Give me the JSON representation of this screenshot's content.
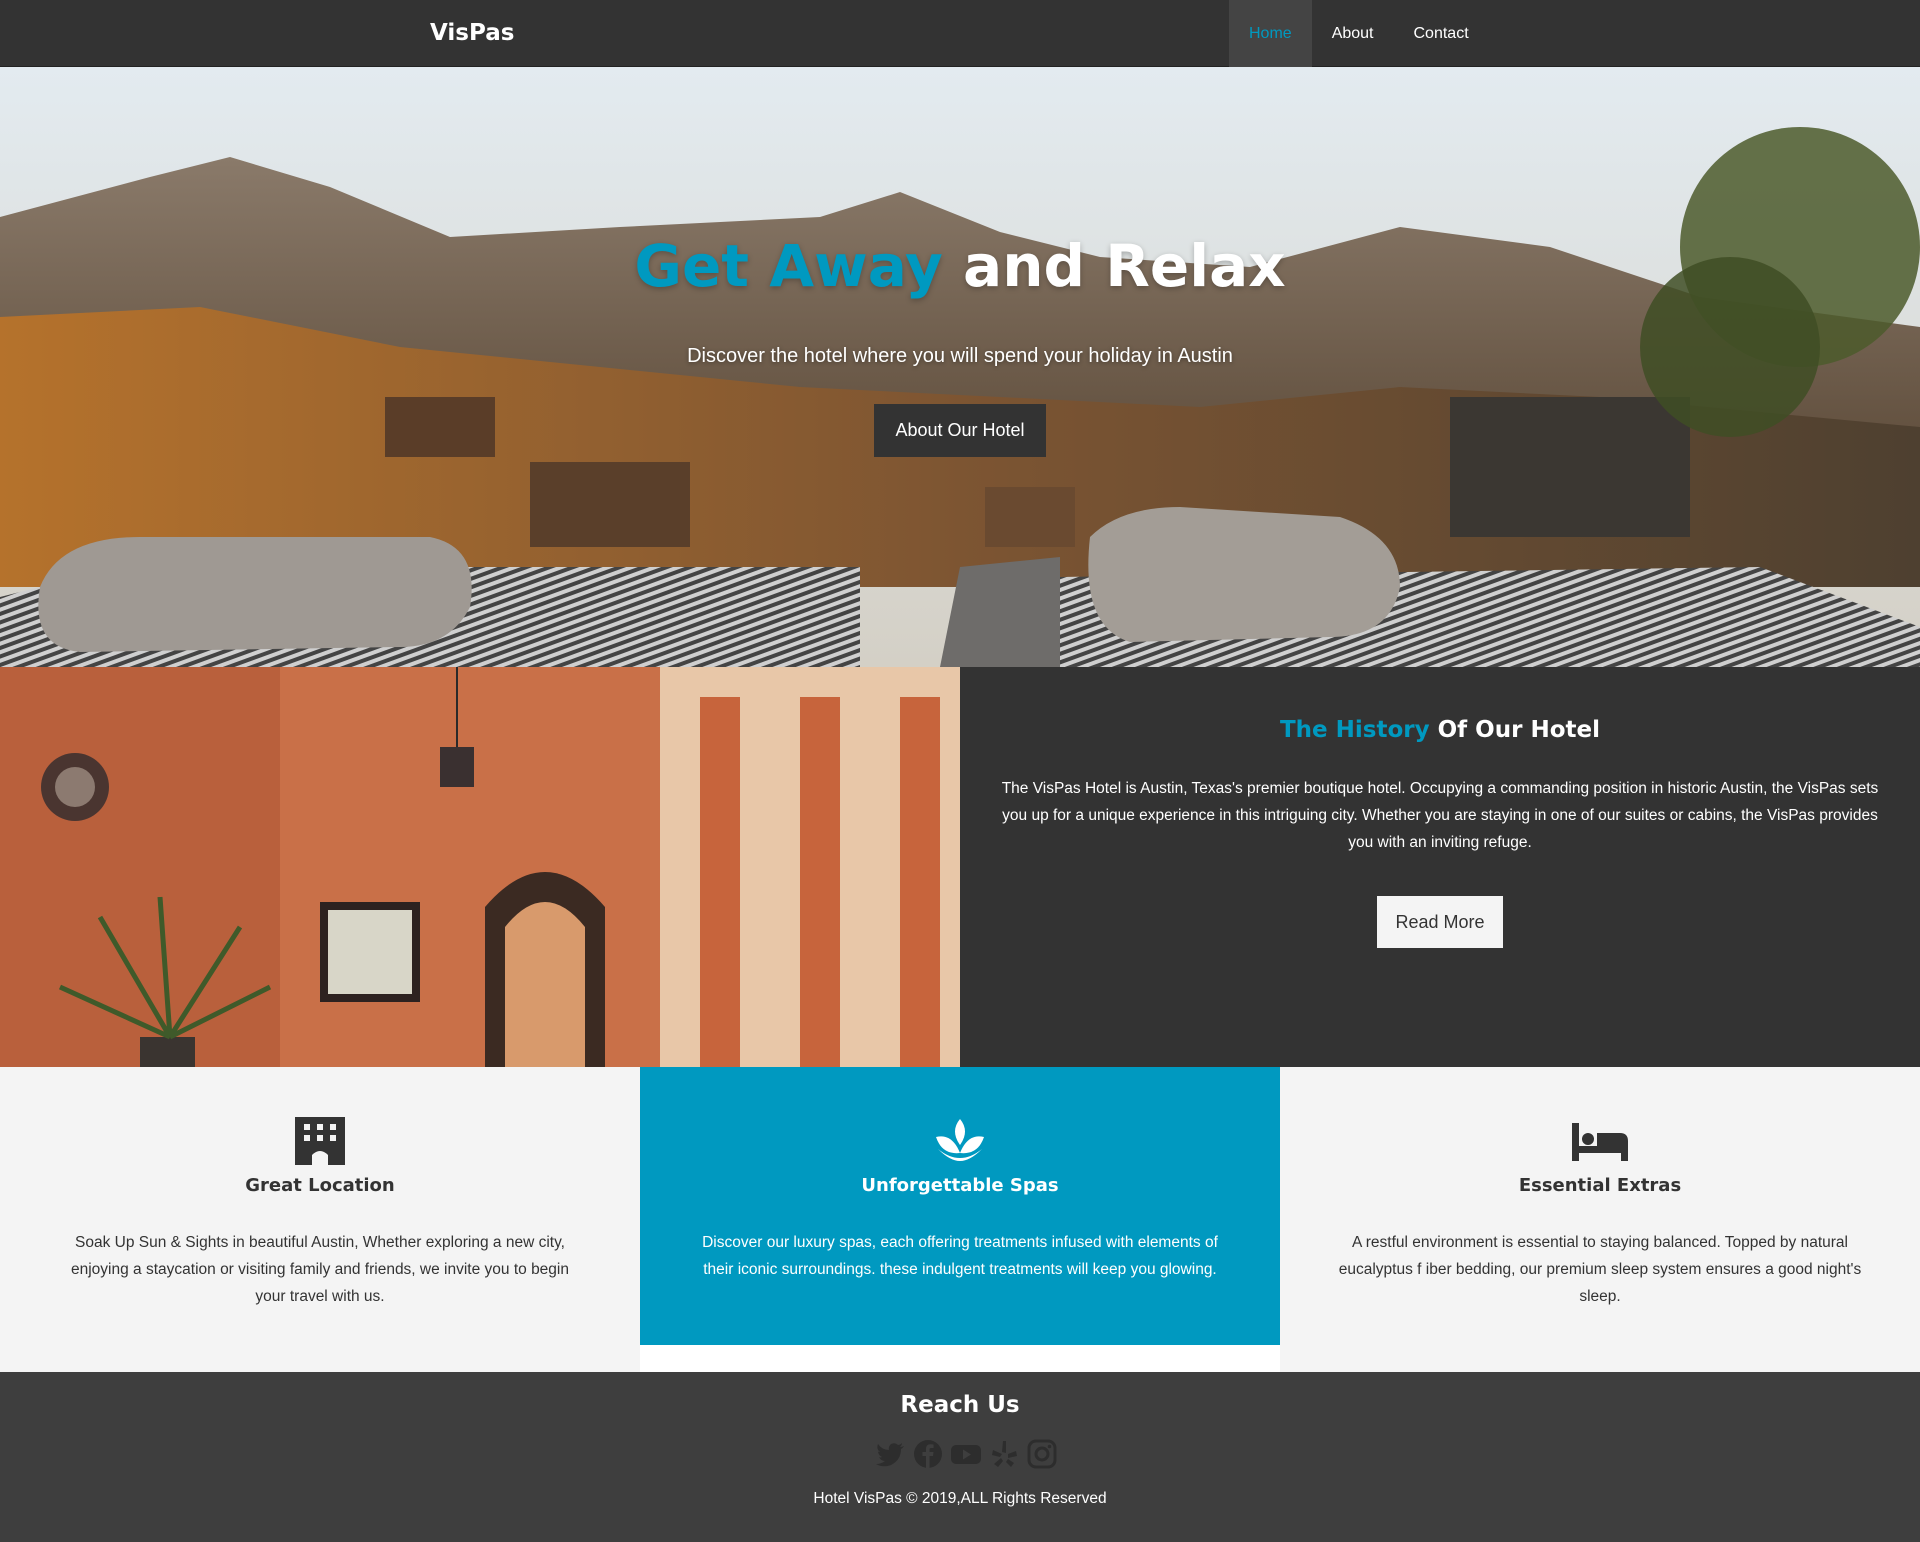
{
  "brand": "VisPas",
  "nav": {
    "home": "Home",
    "about": "About",
    "contact": "Contact"
  },
  "hero": {
    "title_accent": "Get Away",
    "title_rest": " and Relax",
    "subtitle": "Discover the hotel where you will spend your holiday in Austin",
    "button": "About Our Hotel"
  },
  "history": {
    "title_accent": "The History",
    "title_rest": " Of Our Hotel",
    "text": "The VisPas Hotel is Austin, Texas's premier boutique hotel. Occupying a commanding position in historic Austin, the VisPas sets you up for a unique experience in this intriguing city. Whether you are staying in one of our suites or cabins, the VisPas provides you with an inviting refuge.",
    "button": "Read More"
  },
  "features": [
    {
      "icon": "building-icon",
      "title": "Great Location",
      "text": "Soak Up Sun & Sights in beautiful Austin, Whether exploring a new city, enjoying a staycation or visiting family and friends, we invite you to begin your travel with us."
    },
    {
      "icon": "spa-lotus-icon",
      "title": "Unforgettable Spas",
      "text": "Discover our luxury spas, each offering treatments infused with elements of their iconic surroundings. these indulgent treatments will keep you glowing."
    },
    {
      "icon": "bed-icon",
      "title": "Essential Extras",
      "text": "A restful environment is essential to staying balanced. Topped by natural eucalyptus f iber bedding, our premium sleep system ensures a good night's sleep."
    }
  ],
  "footer": {
    "title": "Reach Us",
    "social_icons": [
      "twitter-icon",
      "facebook-icon",
      "youtube-icon",
      "yelp-icon",
      "instagram-icon"
    ],
    "copyright": "Hotel VisPas © 2019,ALL Rights Reserved"
  },
  "colors": {
    "accent": "#0099c0",
    "dark": "#333333",
    "light": "#f4f4f4"
  }
}
